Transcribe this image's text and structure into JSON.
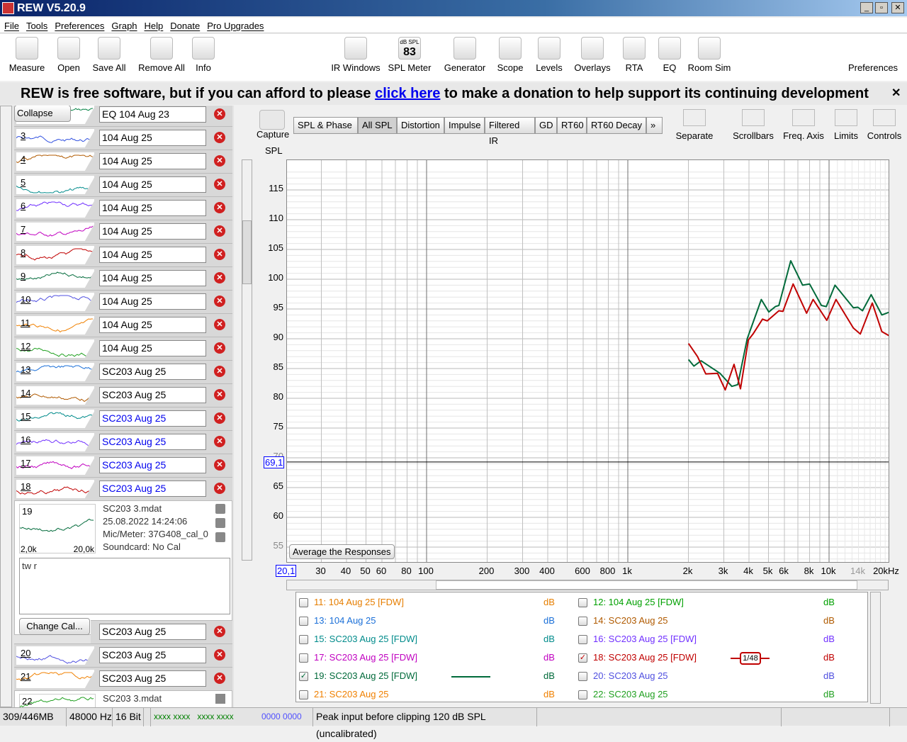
{
  "window": {
    "title": "REW V5.20.9",
    "min": "_",
    "max": "▫",
    "close": "✕"
  },
  "menu": [
    "File",
    "Tools",
    "Preferences",
    "Graph",
    "Help",
    "Donate",
    "Pro Upgrades"
  ],
  "toolbar_left": [
    {
      "label": "Measure",
      "icon": "measure-icon"
    },
    {
      "label": "Open",
      "icon": "folder-icon"
    },
    {
      "label": "Save All",
      "icon": "save-all-icon"
    },
    {
      "label": "Remove All",
      "icon": "remove-all-icon"
    },
    {
      "label": "Info",
      "icon": "info-icon"
    }
  ],
  "toolbar_right": [
    {
      "label": "IR Windows",
      "icon": "ir-windows-icon"
    },
    {
      "label": "SPL Meter",
      "icon": "spl-meter-icon",
      "badge": "83",
      "badge_top": "dB SPL"
    },
    {
      "label": "Generator",
      "icon": "generator-icon"
    },
    {
      "label": "Scope",
      "icon": "scope-icon"
    },
    {
      "label": "Levels",
      "icon": "levels-icon"
    },
    {
      "label": "Overlays",
      "icon": "overlays-icon"
    },
    {
      "label": "RTA",
      "icon": "rta-icon"
    },
    {
      "label": "EQ",
      "icon": "eq-icon"
    },
    {
      "label": "Room Sim",
      "icon": "room-sim-icon"
    }
  ],
  "preferences_label": "Preferences",
  "banner": {
    "before": "REW is free software, but if you can afford to please ",
    "link": "click here",
    "after": " to make a donation to help support its continuing development",
    "close": "✕"
  },
  "left": {
    "collapse_label": "Collapse",
    "top_row": {
      "name": "EQ 104 Aug 23",
      "color": "#008040"
    },
    "rows": [
      {
        "num": "3",
        "name": "104 Aug 25",
        "color": "#3050e0",
        "blue": false
      },
      {
        "num": "4",
        "name": "104 Aug 25",
        "color": "#b05a00",
        "blue": false
      },
      {
        "num": "5",
        "name": "104 Aug 25",
        "color": "#008b8b",
        "blue": false
      },
      {
        "num": "6",
        "name": "104 Aug 25",
        "color": "#7030ff",
        "blue": false
      },
      {
        "num": "7",
        "name": "104 Aug 25",
        "color": "#c000c0",
        "blue": false
      },
      {
        "num": "8",
        "name": "104 Aug 25",
        "color": "#c00000",
        "blue": false
      },
      {
        "num": "9",
        "name": "104 Aug 25",
        "color": "#006a3a",
        "blue": false
      },
      {
        "num": "10",
        "name": "104 Aug 25",
        "color": "#5050e0",
        "blue": false
      },
      {
        "num": "11",
        "name": "104 Aug 25",
        "color": "#f08000",
        "blue": false
      },
      {
        "num": "12",
        "name": "104 Aug 25",
        "color": "#20a020",
        "blue": false
      },
      {
        "num": "13",
        "name": "SC203 Aug 25",
        "color": "#1a6fd8",
        "blue": false
      },
      {
        "num": "14",
        "name": "SC203 Aug 25",
        "color": "#b05a00",
        "blue": false
      },
      {
        "num": "15",
        "name": "SC203 Aug 25",
        "color": "#008b8b",
        "blue": true
      },
      {
        "num": "16",
        "name": "SC203 Aug 25",
        "color": "#7030ff",
        "blue": true
      },
      {
        "num": "17",
        "name": "SC203 Aug 25",
        "color": "#c000c0",
        "blue": true
      },
      {
        "num": "18",
        "name": "SC203 Aug 25",
        "color": "#c00000",
        "blue": true
      }
    ],
    "expanded": {
      "num": "19",
      "file": "SC203 3.mdat",
      "date": "25.08.2022 14:24:06",
      "mic": "Mic/Meter: 37G408_cal_0",
      "soundcard": "Soundcard: No Cal",
      "thumb_xmin": "2,0k",
      "thumb_xmax": "20,0k",
      "notes": "tw r",
      "change_cal": "Change Cal...",
      "name": "SC203 Aug 25",
      "color": "#006a3a"
    },
    "rows_after": [
      {
        "num": "20",
        "name": "SC203 Aug 25",
        "color": "#5050e0"
      },
      {
        "num": "21",
        "name": "SC203 Aug 25",
        "color": "#f08000"
      }
    ],
    "last": {
      "num": "22",
      "file": "SC203 3.mdat",
      "color": "#20a020"
    }
  },
  "graph": {
    "capture": "Capture",
    "tabs": [
      {
        "label": "SPL & Phase"
      },
      {
        "label": "All SPL",
        "selected": true
      },
      {
        "label": "Distortion"
      },
      {
        "label": "Impulse"
      },
      {
        "label": "Filtered IR"
      },
      {
        "label": "GD"
      },
      {
        "label": "RT60"
      },
      {
        "label": "RT60 Decay"
      },
      {
        "label": "»"
      }
    ],
    "right_buttons": [
      "Separate",
      "Scrollbars",
      "Freq. Axis",
      "Limits",
      "Controls"
    ],
    "average_btn": "Average the Responses"
  },
  "chart_data": {
    "type": "line",
    "ylabel": "SPL",
    "xscale": "log",
    "xlim": [
      20,
      20000
    ],
    "ylim": [
      53,
      118
    ],
    "grid": true,
    "yticks": [
      "115",
      "110",
      "105",
      "100",
      "95",
      "90",
      "85",
      "80",
      "75",
      "70",
      "65",
      "60",
      "55"
    ],
    "xticks": [
      {
        "v": 30,
        "t": "30"
      },
      {
        "v": 40,
        "t": "40"
      },
      {
        "v": 50,
        "t": "50"
      },
      {
        "v": 60,
        "t": "60"
      },
      {
        "v": 80,
        "t": "80"
      },
      {
        "v": 100,
        "t": "100"
      },
      {
        "v": 200,
        "t": "200"
      },
      {
        "v": 300,
        "t": "300"
      },
      {
        "v": 400,
        "t": "400"
      },
      {
        "v": 600,
        "t": "600"
      },
      {
        "v": 800,
        "t": "800"
      },
      {
        "v": 1000,
        "t": "1k"
      },
      {
        "v": 2000,
        "t": "2k"
      },
      {
        "v": 3000,
        "t": "3k"
      },
      {
        "v": 4000,
        "t": "4k"
      },
      {
        "v": 5000,
        "t": "5k"
      },
      {
        "v": 6000,
        "t": "6k"
      },
      {
        "v": 8000,
        "t": "8k"
      },
      {
        "v": 10000,
        "t": "10k"
      },
      {
        "v": 14000,
        "t": "14k",
        "grey": true
      },
      {
        "v": 20000,
        "t": "20kHz"
      }
    ],
    "cursor": {
      "x_label": "20,1",
      "y_label": "69,1",
      "y": 69.3
    },
    "series": [
      {
        "name": "19: SC203 Aug 25 [FDW]",
        "color": "#006a3a",
        "x": [
          2003,
          2131,
          2312,
          2870,
          3287,
          3520,
          3920,
          4605,
          5020,
          5410,
          5630,
          6450,
          7390,
          8000,
          9160,
          9690,
          10700,
          13200,
          13900,
          14660,
          16180,
          18300,
          20000
        ],
        "y": [
          86.5,
          85.4,
          86.3,
          84.2,
          82.0,
          82.3,
          90.0,
          96.6,
          94.5,
          95.4,
          95.6,
          103.1,
          99.0,
          99.2,
          95.6,
          95.4,
          99.0,
          95.2,
          95.3,
          94.7,
          97.4,
          94.0,
          94.5
        ]
      },
      {
        "name": "18: SC203 Aug 25 [FDW]",
        "color": "#c00000",
        "x": [
          2003,
          2220,
          2440,
          2790,
          3050,
          3370,
          3630,
          3970,
          4190,
          4670,
          4930,
          5630,
          5900,
          6630,
          7730,
          8330,
          9740,
          10830,
          13200,
          14300,
          16400,
          18300,
          19900
        ],
        "y": [
          89.2,
          87.0,
          84.1,
          84.2,
          81.4,
          85.7,
          81.6,
          89.8,
          90.8,
          93.3,
          93.0,
          94.7,
          94.6,
          99.2,
          94.3,
          96.6,
          93.1,
          96.6,
          91.8,
          90.8,
          96.0,
          91.2,
          90.5
        ]
      }
    ]
  },
  "legend": [
    {
      "label": "11: 104 Aug 25 [FDW]",
      "unit": "dB",
      "color": "#e67e00",
      "checked": false
    },
    {
      "label": "12: 104 Aug 25 [FDW]",
      "unit": "dB",
      "color": "#00a000",
      "checked": false
    },
    {
      "label": "13: 104 Aug 25",
      "unit": "dB",
      "color": "#1a6fd8",
      "checked": false
    },
    {
      "label": "14: SC203 Aug 25",
      "unit": "dB",
      "color": "#b05a00",
      "checked": false
    },
    {
      "label": "15: SC203 Aug 25 [FDW]",
      "unit": "dB",
      "color": "#008b8b",
      "checked": false
    },
    {
      "label": "16: SC203 Aug 25 [FDW]",
      "unit": "dB",
      "color": "#7030ff",
      "checked": false
    },
    {
      "label": "17: SC203 Aug 25 [FDW]",
      "unit": "dB",
      "color": "#c000c0",
      "checked": false
    },
    {
      "label": "18: SC203 Aug 25 [FDW]",
      "unit": "dB",
      "color": "#c00000",
      "checked": true,
      "smoothing": "1/48"
    },
    {
      "label": "19: SC203 Aug 25 [FDW]",
      "unit": "dB",
      "color": "#006a3a",
      "checked": true,
      "line": true
    },
    {
      "label": "20: SC203 Aug 25",
      "unit": "dB",
      "color": "#5050e0",
      "checked": false
    },
    {
      "label": "21: SC203 Aug 25",
      "unit": "dB",
      "color": "#f08000",
      "checked": false
    },
    {
      "label": "22: SC203 Aug 25",
      "unit": "dB",
      "color": "#20a020",
      "checked": false
    }
  ],
  "status": {
    "memory": "309/446MB",
    "rate": "48000 Hz",
    "bits": "16 Bit",
    "in_levels": "xxxx xxxx   xxxx xxxx",
    "out_levels": "0000 0000",
    "message": "Peak input before clipping 120 dB SPL (uncalibrated)"
  }
}
